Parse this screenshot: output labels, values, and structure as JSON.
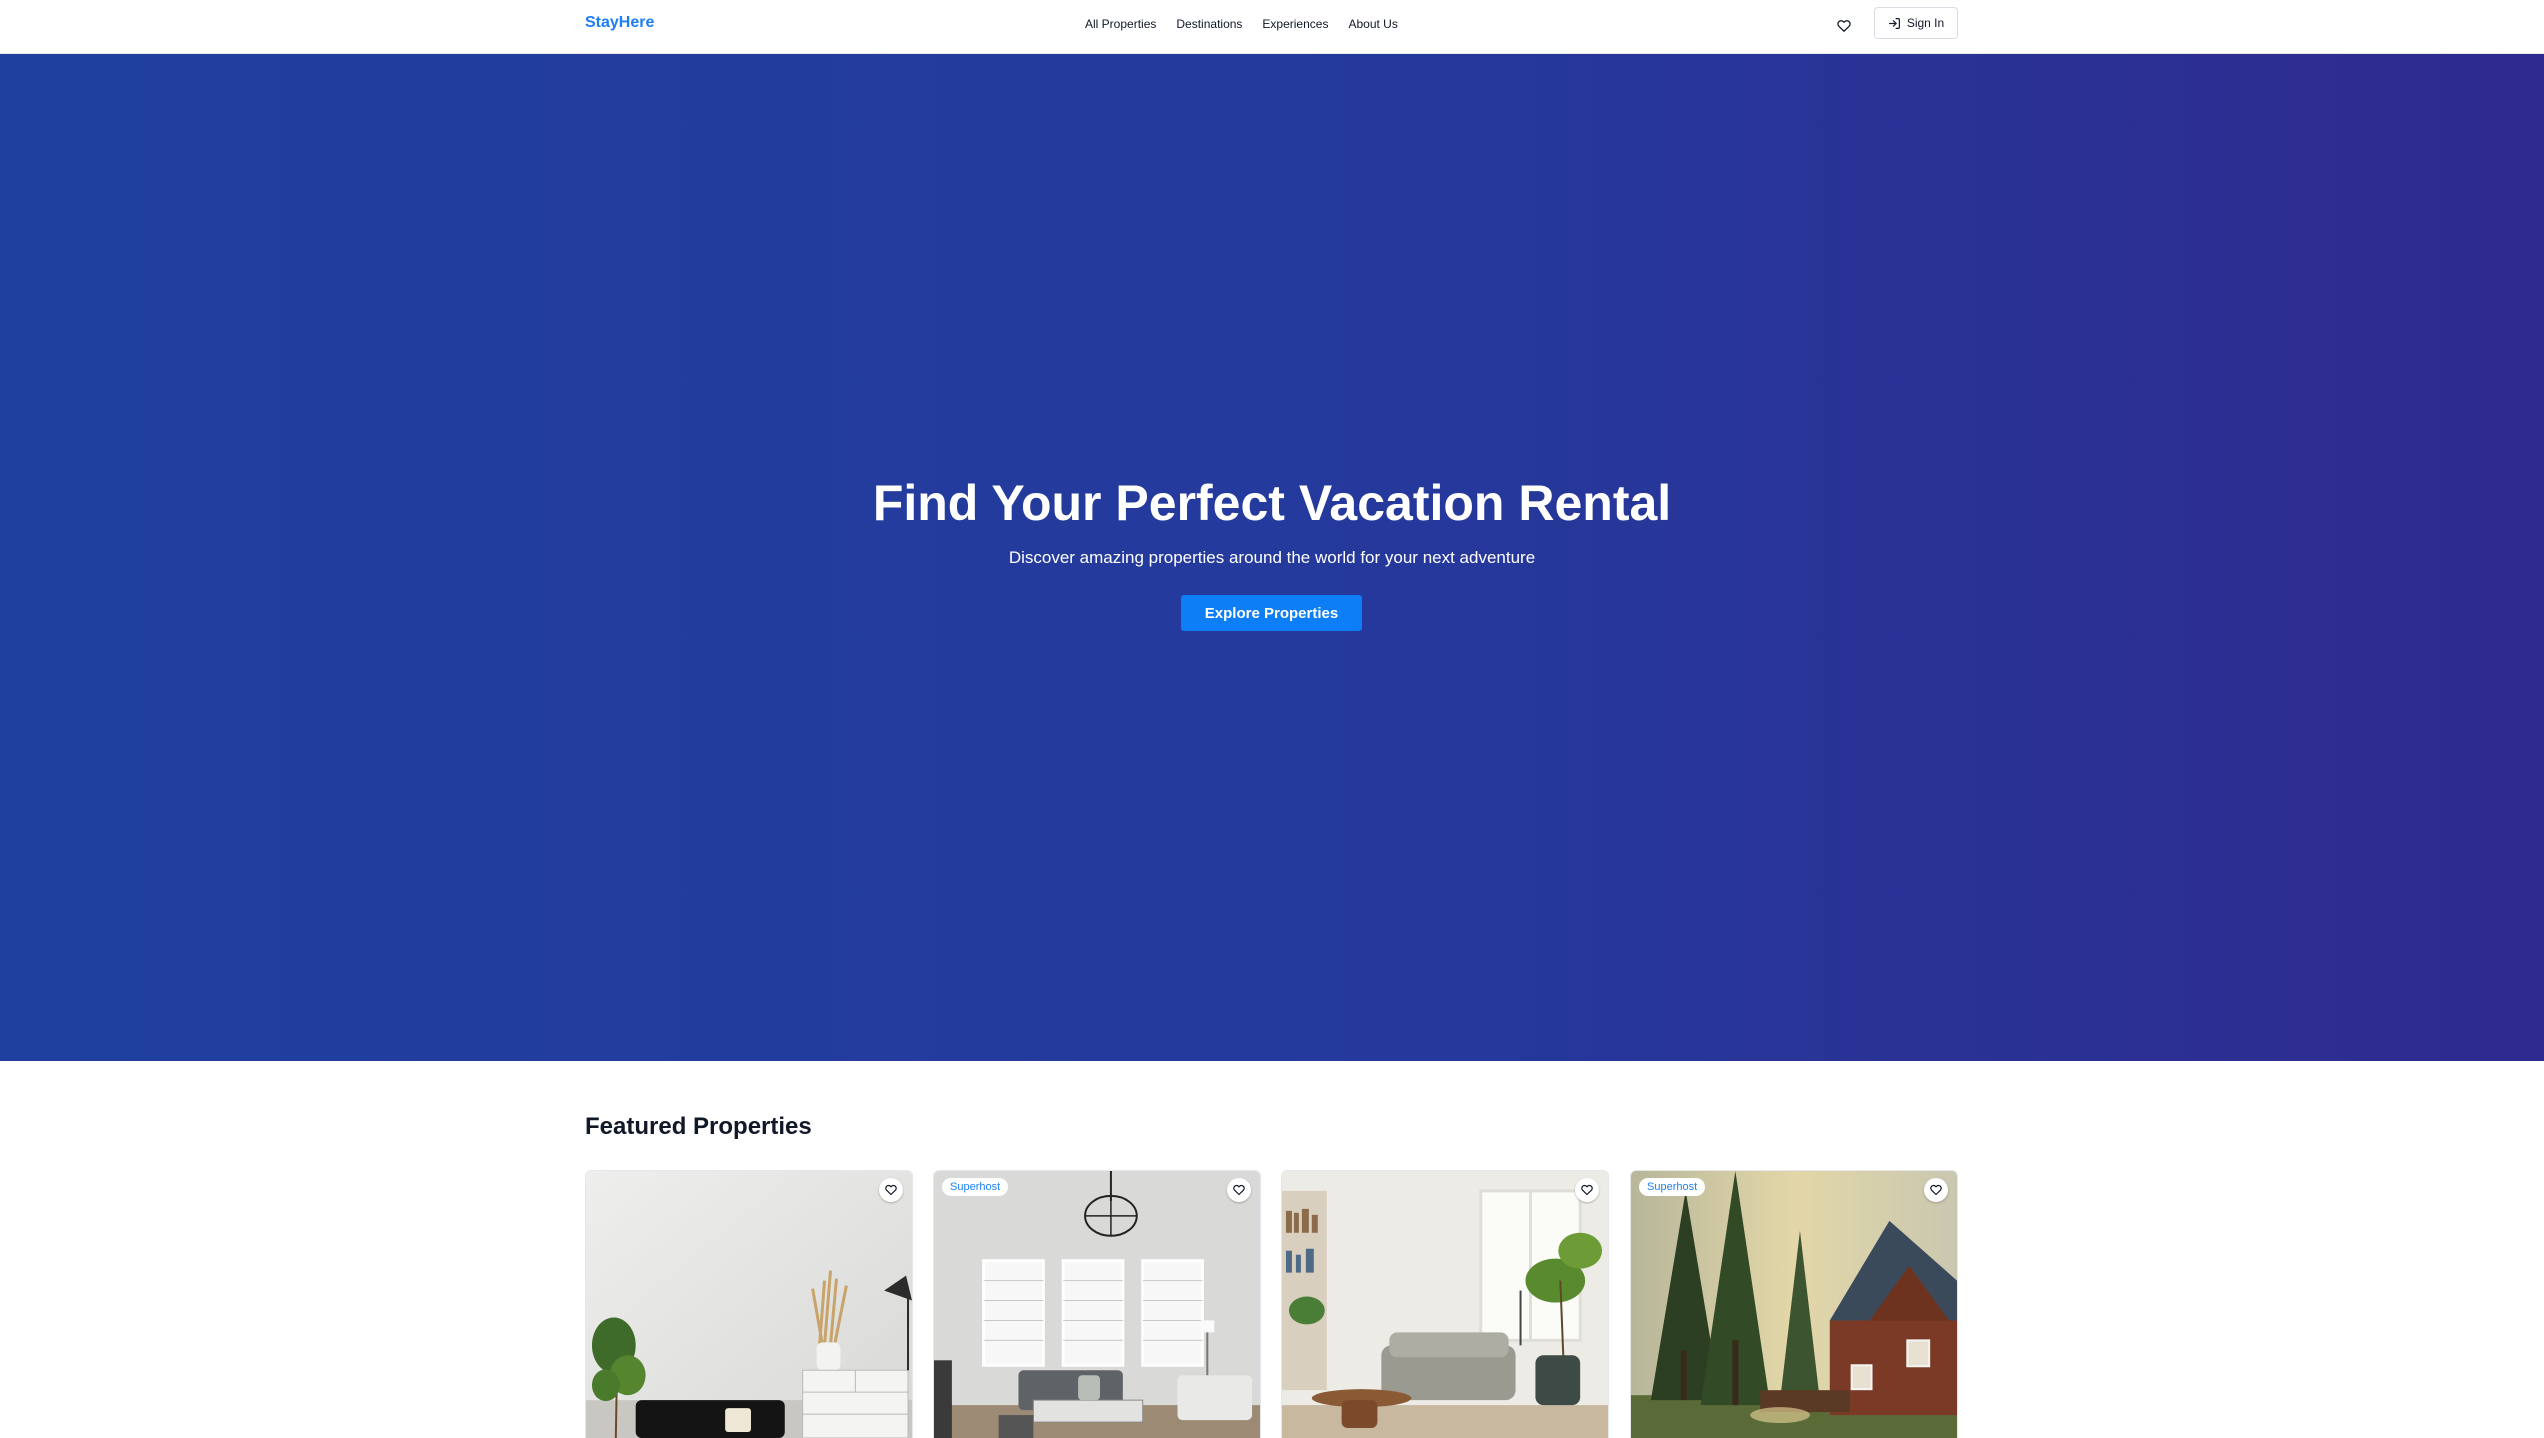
{
  "brand": "StayHere",
  "nav": {
    "links": [
      "All Properties",
      "Destinations",
      "Experiences",
      "About Us"
    ],
    "signin_label": "Sign In",
    "wishlist_icon": "heart-icon",
    "signin_icon": "log-in-icon"
  },
  "hero": {
    "title": "Find Your Perfect Vacation Rental",
    "subtitle": "Discover amazing properties around the world for your next adventure",
    "cta": "Explore Properties"
  },
  "featured": {
    "title": "Featured Properties",
    "cards": [
      {
        "badge": "",
        "favorite_icon": "heart-icon",
        "photo": "white room with dresser, plant and black sofa"
      },
      {
        "badge": "Superhost",
        "favorite_icon": "heart-icon",
        "photo": "grey living room with large windows and chandelier"
      },
      {
        "badge": "",
        "favorite_icon": "heart-icon",
        "photo": "sunlit living room with grey sofa and plants"
      },
      {
        "badge": "Superhost",
        "favorite_icon": "heart-icon",
        "photo": "brick house among trees"
      }
    ]
  },
  "colors": {
    "accent": "#1d7ff2",
    "cta": "#0d7ef5",
    "hero_start": "#1f409e",
    "hero_end": "#2f2a8f"
  }
}
